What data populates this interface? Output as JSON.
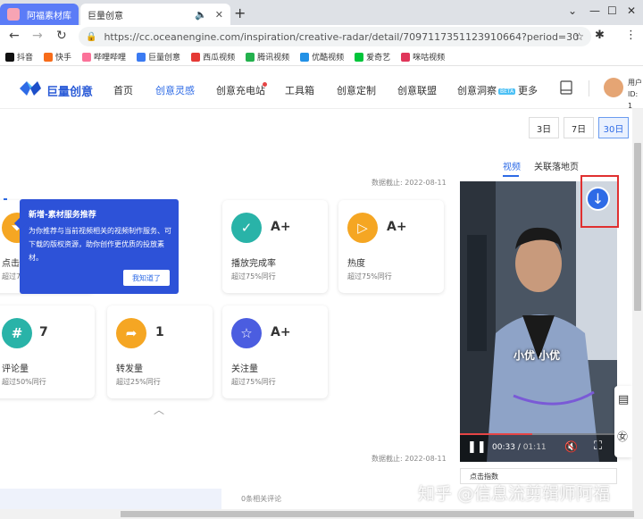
{
  "browser": {
    "tabs": [
      {
        "title": "阿福素材库",
        "active": false
      },
      {
        "title": "巨量创意",
        "active": true
      }
    ],
    "url": "https://cc.oceanengine.com/inspiration/creative-radar/detail/7097117351123910664?period=30",
    "bookmarks": [
      "抖音",
      "快手",
      "哔哩哔哩",
      "巨量创意",
      "西瓜视频",
      "腾讯视频",
      "优酷视频",
      "爱奇艺",
      "咪咕视频"
    ]
  },
  "site": {
    "logo": "巨量创意",
    "nav": [
      "首页",
      "创意灵感",
      "创意充电站",
      "工具箱",
      "创意定制",
      "创意联盟",
      "创意洞察",
      "更多"
    ],
    "nav_active": "创意灵感",
    "beta_badge": "BETA",
    "user_label": "用户",
    "user_id_prefix": "ID: 1"
  },
  "content": {
    "ranges": [
      "3日",
      "7日",
      "30日"
    ],
    "range_selected": "30日",
    "deadline_top": "数据截止: 2022-08-11",
    "deadline_bottom": "数据截止: 2022-08-11",
    "media_tabs": [
      "视频",
      "关联落地页"
    ],
    "cards": [
      {
        "label": "点击",
        "grade": "",
        "sub": "超过7",
        "icon": "funnel-icon",
        "color": "#f5a623"
      },
      {
        "label": "播放完成率",
        "grade": "A+",
        "sub": "超过75%同行",
        "icon": "check-icon",
        "color": "#29b3a8"
      },
      {
        "label": "热度",
        "grade": "A+",
        "sub": "超过75%同行",
        "icon": "play-icon",
        "color": "#f5a623"
      },
      {
        "label": "评论量",
        "grade": "7",
        "sub": "超过50%同行",
        "icon": "hash-icon",
        "color": "#29b3a8"
      },
      {
        "label": "转发量",
        "grade": "1",
        "sub": "超过25%同行",
        "icon": "share-icon",
        "color": "#f5a623"
      },
      {
        "label": "关注量",
        "grade": "A+",
        "sub": "超过75%同行",
        "icon": "star-icon",
        "color": "#4b5de0"
      }
    ],
    "tooltip": {
      "title": "新增-素材服务推荐",
      "body": "为你推荐与当前视频相关的视频制作服务、可下载的版权资源，助你创作更优质的投放素材。",
      "button": "我知道了"
    },
    "video": {
      "caption": "小优 小优",
      "time_current": "00:33",
      "time_total": "01:11",
      "progress": 0.46
    },
    "select_label": "点击指数",
    "comments": "0条相关评论",
    "watermark": "知乎 @信息流剪辑师阿福"
  }
}
